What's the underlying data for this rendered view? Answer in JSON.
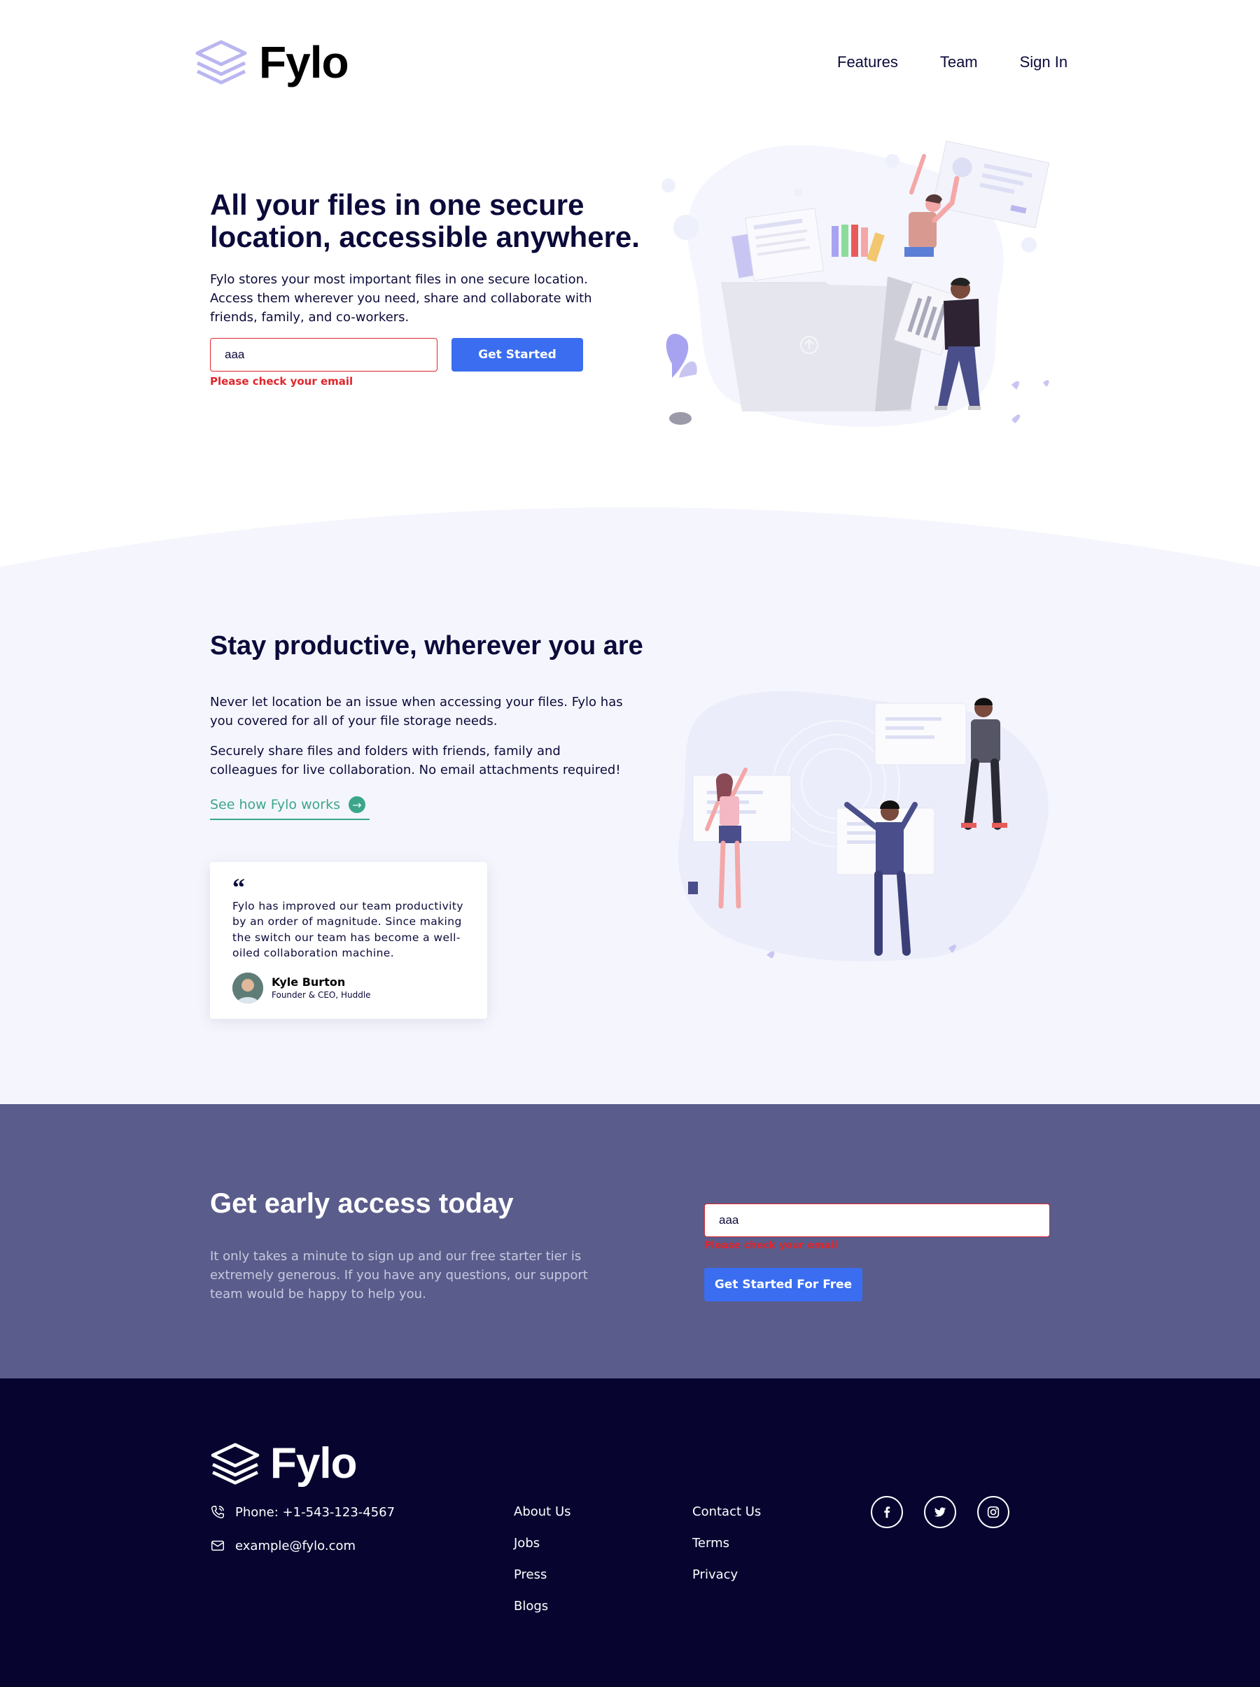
{
  "header": {
    "brand": "Fylo",
    "nav": [
      {
        "label": "Features"
      },
      {
        "label": "Team"
      },
      {
        "label": "Sign In"
      }
    ]
  },
  "hero": {
    "title": "All your files in one secure location, accessible anywhere.",
    "description": "Fylo stores your most important files in one secure location. Access them wherever you need, share and collaborate with friends, family, and co-workers.",
    "email_value": "aaa",
    "error": "Please check your email",
    "button": "Get Started"
  },
  "productive": {
    "title": "Stay productive, wherever you are",
    "p1": "Never let location be an issue when accessing your files. Fylo has you covered for all of your file storage needs.",
    "p2": "Securely share files and folders with friends, family and colleagues for live collaboration. No email attachments required!",
    "link": "See how Fylo works",
    "testimonial": {
      "quote": "Fylo has improved our team productivity by an order of magnitude. Since making the switch our team has become a well-oiled collaboration machine.",
      "name": "Kyle Burton",
      "role": "Founder & CEO, Huddle"
    }
  },
  "early_access": {
    "title": "Get early access today",
    "description": "It only takes a minute to sign up and our free starter tier is extremely generous. If you have any questions, our support team would be happy to help you.",
    "email_value": "aaa",
    "error": "Please check your email",
    "button": "Get Started For Free"
  },
  "footer": {
    "brand": "Fylo",
    "phone": "Phone: +1-543-123-4567",
    "email": "example@fylo.com",
    "col1": [
      {
        "label": "About Us"
      },
      {
        "label": "Jobs"
      },
      {
        "label": "Press"
      },
      {
        "label": "Blogs"
      }
    ],
    "col2": [
      {
        "label": "Contact Us"
      },
      {
        "label": "Terms"
      },
      {
        "label": "Privacy"
      }
    ],
    "socials": [
      "facebook-icon",
      "twitter-icon",
      "instagram-icon"
    ]
  },
  "colors": {
    "navy": "#0b0a3a",
    "accent_blue": "#3a6df0",
    "teal": "#3ba68a",
    "error_red": "#e0262c",
    "early_bg": "#5a5c8b",
    "footer_bg": "#070530",
    "logo_lavender": "#b9b6f0"
  }
}
